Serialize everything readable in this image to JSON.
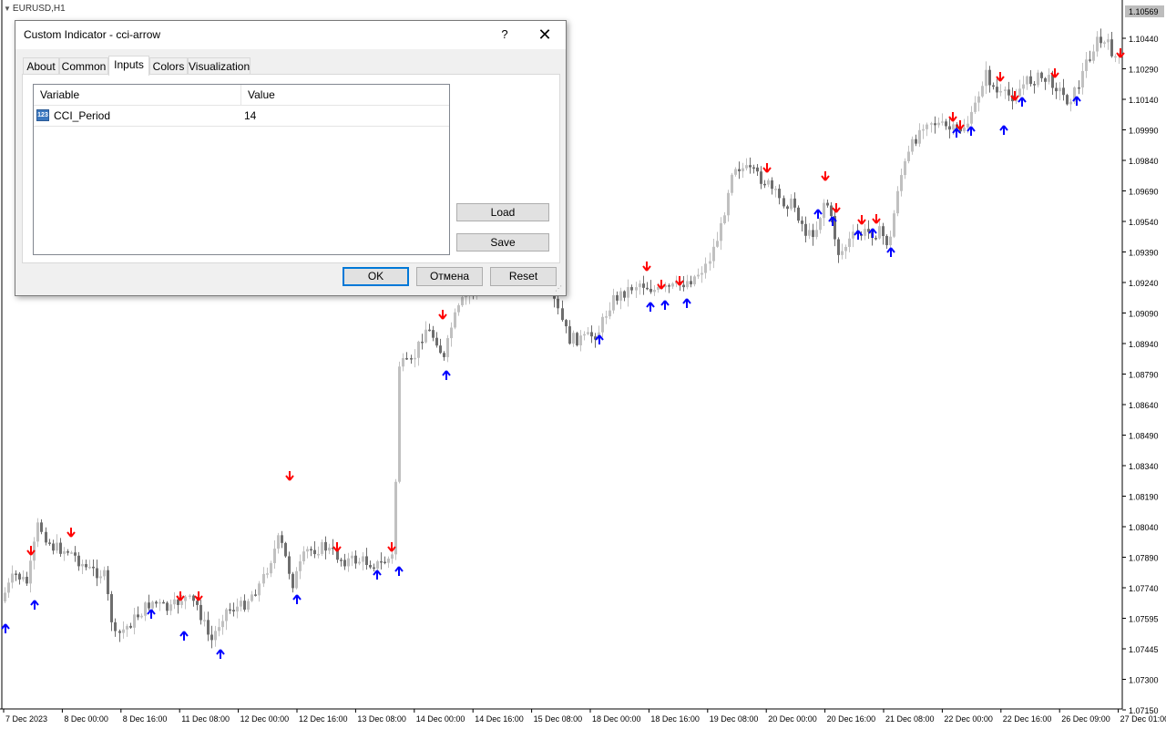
{
  "chart": {
    "title": "EURUSD,H1",
    "current_price": "1.10569",
    "price_labels": [
      "1.10440",
      "1.10290",
      "1.10140",
      "1.09990",
      "1.09840",
      "1.09690",
      "1.09540",
      "1.09390",
      "1.09240",
      "1.09090",
      "1.08940",
      "1.08790",
      "1.08640",
      "1.08490",
      "1.08340",
      "1.08190",
      "1.08040",
      "1.07890",
      "1.07740",
      "1.07595",
      "1.07445",
      "1.07300",
      "1.07150"
    ],
    "time_labels": [
      "7 Dec 2023",
      "8 Dec 00:00",
      "8 Dec 16:00",
      "11 Dec 08:00",
      "12 Dec 00:00",
      "12 Dec 16:00",
      "13 Dec 08:00",
      "14 Dec 00:00",
      "14 Dec 16:00",
      "15 Dec 08:00",
      "18 Dec 00:00",
      "18 Dec 16:00",
      "19 Dec 08:00",
      "20 Dec 00:00",
      "20 Dec 16:00",
      "21 Dec 08:00",
      "22 Dec 00:00",
      "22 Dec 16:00",
      "26 Dec 09:00",
      "27 Dec 01:00"
    ],
    "colors": {
      "bull": "#c0c0c0",
      "bear": "#6e6e6e",
      "arrow_up": "#0000ff",
      "arrow_down": "#ff0000",
      "price_tag": "#bdbdbd"
    }
  },
  "dialog": {
    "title": "Custom Indicator - cci-arrow",
    "help_label": "?",
    "close_label": "✕",
    "tabs": [
      {
        "label": "About"
      },
      {
        "label": "Common"
      },
      {
        "label": "Inputs"
      },
      {
        "label": "Colors"
      },
      {
        "label": "Visualization"
      }
    ],
    "active_tab": "Inputs",
    "table": {
      "col_variable": "Variable",
      "col_value": "Value",
      "rows": [
        {
          "icon": "integer-param-icon",
          "icon_text": "123",
          "variable": "CCI_Period",
          "value": "14"
        }
      ]
    },
    "buttons": {
      "load": "Load",
      "save": "Save",
      "ok": "OK",
      "cancel": "Отмена",
      "reset": "Reset"
    }
  }
}
